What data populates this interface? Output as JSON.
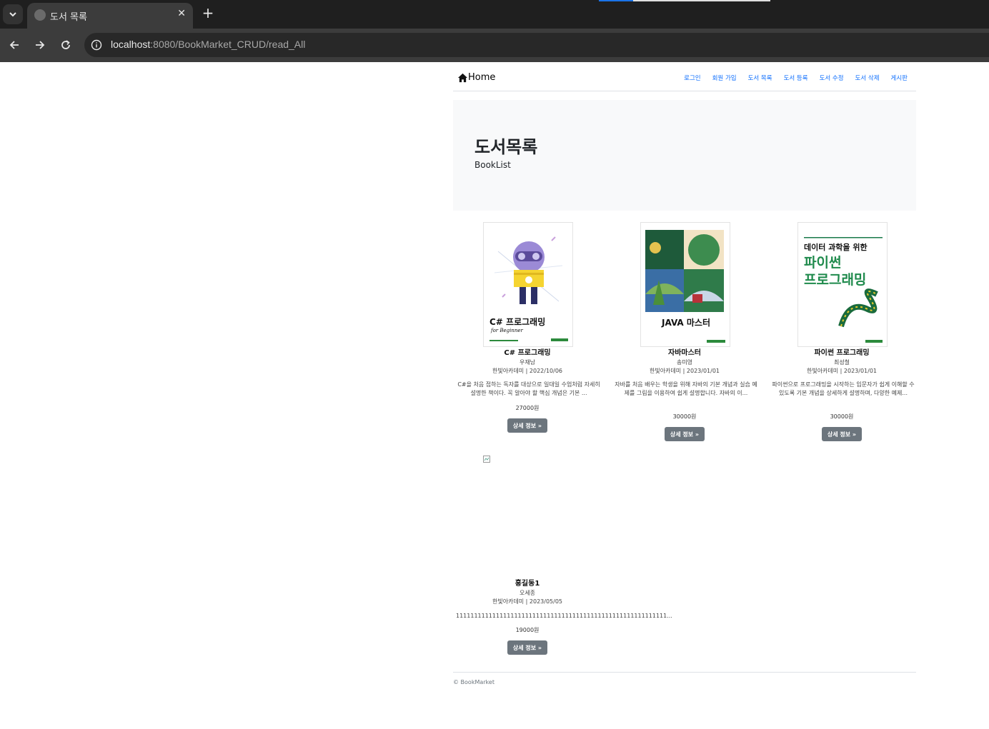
{
  "browser": {
    "tab_title": "도서 목록",
    "url_host": "localhost",
    "url_rest": ":8080/BookMarket_CRUD/read_All"
  },
  "navbar": {
    "brand": "Home",
    "links": [
      "로그인",
      "회원 가입",
      "도서 목록",
      "도서 등록",
      "도서 수정",
      "도서 삭제",
      "게시판"
    ]
  },
  "jumbotron": {
    "title": "도서목록",
    "subtitle": "BookList"
  },
  "books": [
    {
      "title": "C# 프로그래밍",
      "author": "우재남",
      "publisher_date": "한빛아카데미 | 2022/10/06",
      "description": "C#을 처음 접하는 독자를 대상으로 일대일 수업처럼 자세히 설명한 책이다. 꼭 알아야 할 핵심 개념은 기본 ...",
      "price": "27000원",
      "button": "상세 정보 »",
      "cover_text": "C# 프로그래밍",
      "cover_sub": "for Beginner"
    },
    {
      "title": "자바마스터",
      "author": "송미영",
      "publisher_date": "한빛아카데미 | 2023/01/01",
      "description": "자바를 처음 배우는 학생을 위해 자바의 기본 개념과 실습 예제를 그림을 이용하여 쉽게 설명합니다. 자바의 이...",
      "price": "30000원",
      "button": "상세 정보 »",
      "cover_text": "JAVA 마스터"
    },
    {
      "title": "파이썬 프로그래밍",
      "author": "최성철",
      "publisher_date": "한빛아카데미 | 2023/01/01",
      "description": "파이썬으로 프로그래밍을 시작하는 입문자가 쉽게 이해할 수 있도록 기본 개념을 상세하게 설명하며, 다양한 예제...",
      "price": "30000원",
      "button": "상세 정보 »",
      "cover_text_1": "데이터 과학을 위한",
      "cover_text_2": "파이썬",
      "cover_text_3": "프로그래밍"
    },
    {
      "title": "홍길동1",
      "author": "오세종",
      "publisher_date": "한빛아카데미 | 2023/05/05",
      "description": "1111111111111111111111111111111111111111111111111111111111...",
      "price": "19000원",
      "button": "상세 정보 »"
    }
  ],
  "footer": "© BookMarket"
}
